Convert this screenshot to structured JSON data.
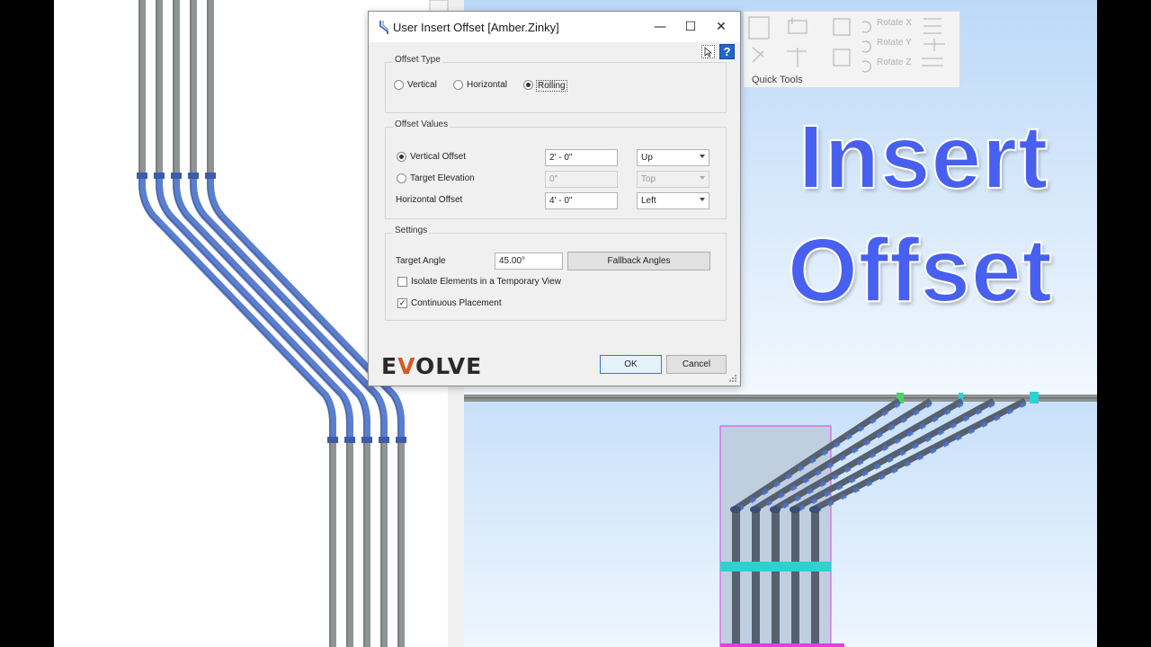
{
  "dialog": {
    "title": "User Insert Offset [Amber.Zinky]",
    "minimize": "—",
    "maximize": "☐",
    "close": "✕",
    "help": "?",
    "offset_type": {
      "label": "Offset Type",
      "options": [
        "Vertical",
        "Horizontal",
        "Rolling"
      ],
      "selected": "Rolling"
    },
    "offset_values": {
      "label": "Offset Values",
      "vertical_offset": {
        "label": "Vertical Offset",
        "value": "2' - 0\"",
        "direction": "Up"
      },
      "target_elevation": {
        "label": "Target Elevation",
        "value": "0\"",
        "direction": "Top"
      },
      "horizontal_offset": {
        "label": "Horizontal Offset",
        "value": "4' - 0\"",
        "direction": "Left"
      }
    },
    "settings": {
      "label": "Settings",
      "target_angle_label": "Target Angle",
      "target_angle_value": "45.00°",
      "fallback_button": "Fallback Angles",
      "isolate_label": "Isolate Elements in a Temporary View",
      "isolate_checked": false,
      "continuous_label": "Continuous Placement",
      "continuous_checked": true,
      "check_mark": "✓"
    },
    "ok_button": "OK",
    "cancel_button": "Cancel",
    "logo": {
      "pre": "E",
      "accent": "V",
      "post": "OLVE"
    }
  },
  "ribbon": {
    "rotate_x": "Rotate X",
    "rotate_y": "Rotate Y",
    "rotate_z": "Rotate Z",
    "group_label": "Quick Tools"
  },
  "overlay": {
    "line1": "Insert",
    "line2": "Offset"
  },
  "colors": {
    "overlay_text": "#4860f0",
    "sky_top": "#cfe4fb",
    "sky_bottom": "#eaf4fe",
    "conduit_gray": "#8f9494",
    "conduit_blue": "#5a7fd0",
    "cyan_fitting": "#2fd0d0",
    "magenta_box": "#e040e0",
    "evolve_accent": "#d35a26"
  }
}
